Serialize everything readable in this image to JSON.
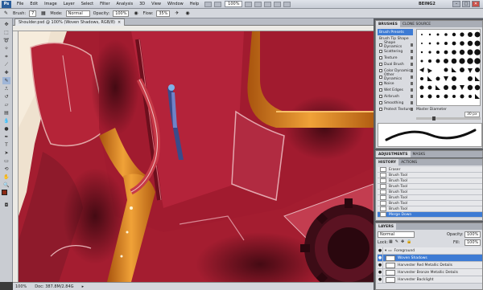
{
  "app": {
    "logo_text": "Ps",
    "workspace": "BEING2"
  },
  "menu": [
    "File",
    "Edit",
    "Image",
    "Layer",
    "Select",
    "Filter",
    "Analysis",
    "3D",
    "View",
    "Window",
    "Help"
  ],
  "zoom_select": "100%",
  "window_buttons": [
    "–",
    "□",
    "✕"
  ],
  "options": {
    "brush_label": "Brush:",
    "brush_size": "7",
    "mode_label": "Mode:",
    "mode_value": "Normal",
    "opacity_label": "Opacity:",
    "opacity_value": "100%",
    "flow_label": "Flow:",
    "flow_value": "35%"
  },
  "document": {
    "tab_title": "Shoulder.psd @ 100% (Woven Shadows, RGB/8)",
    "tab_close": "×",
    "zoom": "100%",
    "doc_size": "Doc: 387.8M/2.84G"
  },
  "brushes_panel": {
    "tabs": [
      "BRUSHES",
      "CLONE SOURCE"
    ],
    "options": [
      {
        "label": "Brush Presets",
        "checkbox": false
      },
      {
        "label": "Brush Tip Shape",
        "checkbox": false
      },
      {
        "label": "Shape Dynamics",
        "checkbox": true
      },
      {
        "label": "Scattering",
        "checkbox": true
      },
      {
        "label": "Texture",
        "checkbox": true
      },
      {
        "label": "Dual Brush",
        "checkbox": true
      },
      {
        "label": "Color Dynamics",
        "checkbox": true
      },
      {
        "label": "Other Dynamics",
        "checkbox": true
      },
      {
        "label": "Noise",
        "checkbox": true
      },
      {
        "label": "Wet Edges",
        "checkbox": true
      },
      {
        "label": "Airbrush",
        "checkbox": true
      },
      {
        "label": "Smoothing",
        "checkbox": true
      },
      {
        "label": "Protect Texture",
        "checkbox": true
      }
    ],
    "master_diameter_label": "Master Diameter",
    "master_diameter_value": "30 px"
  },
  "adjustments_tabs": [
    "ADJUSTMENTS",
    "MASKS"
  ],
  "history_panel": {
    "tabs": [
      "HISTORY",
      "ACTIONS"
    ],
    "steps": [
      "Eraser",
      "Brush Tool",
      "Brush Tool",
      "Brush Tool",
      "Brush Tool",
      "Brush Tool",
      "Brush Tool",
      "Brush Tool",
      "Merge Down"
    ]
  },
  "layers_panel": {
    "tabs": [
      "LAYERS"
    ],
    "blend_mode": "Normal",
    "opacity_label": "Opacity:",
    "opacity_value": "100%",
    "lock_label": "Lock:",
    "fill_label": "Fill:",
    "fill_value": "100%",
    "group_name": "Foreground",
    "layers": [
      "Woven Shadows",
      "Harvester Red Metallic Details",
      "Harvester Bronze Metallic Details",
      "Harvester Backlight"
    ]
  },
  "colors": {
    "primary": "#8b2a14",
    "secondary": "#ffffff",
    "accent": "#3d7bd4"
  }
}
